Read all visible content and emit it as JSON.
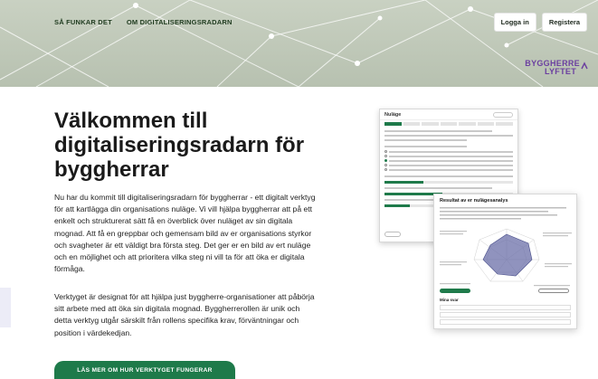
{
  "nav": {
    "links": [
      "SÅ FUNKAR DET",
      "OM DIGITALISERINGSRADARN"
    ],
    "login_label": "Logga in",
    "register_label": "Registera"
  },
  "brand": {
    "line1": "BYGGHERRE",
    "line2": "LYFTET",
    "color": "#6b3fa0"
  },
  "main": {
    "title": "Välkommen till digitaliseringsradarn för byggherrar",
    "intro": "Nu har du kommit till digitaliseringsradarn för byggherrar - ett digitalt verktyg för att kartlägga din organisations nuläge. Vi vill hjälpa byggherrar att på ett enkelt och strukturerat sätt få en överblick över nuläget av sin digitala mognad. Att få en greppbar och gemensam bild av er organisations styrkor och svagheter är ett väldigt bra första steg. Det ger er en bild av ert nuläge och en möjlighet och att prioritera vilka steg ni vill ta för att öka er digitala förmåga.",
    "intro2": "Verktyget är designat för att hjälpa just byggherre-organisationer att påbörja sitt arbete med att öka sin digitala mognad. Byggherrerollen är unik och detta verktyg utgår särskilt från rollens specifika krav, förväntningar och position i värdekedjan.",
    "cta_label": "LÄS MER OM HUR VERKTYGET FUNGERAR",
    "accent": "#1e7a4a"
  },
  "preview": {
    "screen1_title": "Nuläge",
    "screen2_title": "Resultat av er nulägesanalys",
    "screen2_sub": "Mina svar"
  }
}
